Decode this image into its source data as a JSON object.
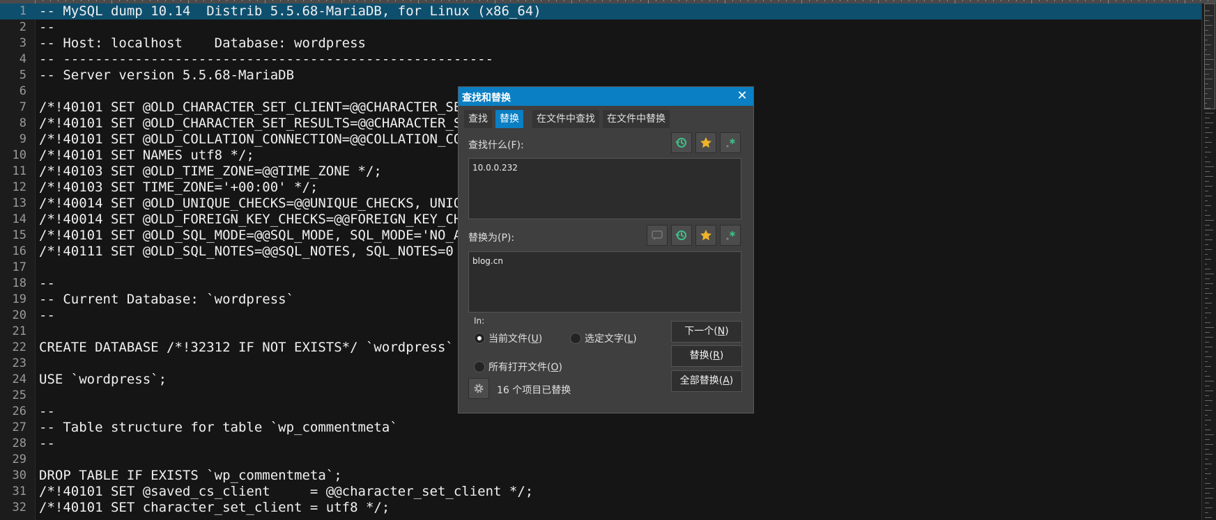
{
  "editor": {
    "current_line": 1,
    "lines": [
      {
        "n": "1",
        "t": "-- MySQL dump 10.14  Distrib 5.5.68-MariaDB, for Linux (x86_64)"
      },
      {
        "n": "2",
        "t": "--"
      },
      {
        "n": "3",
        "t": "-- Host: localhost    Database: wordpress"
      },
      {
        "n": "4",
        "t": "-- ------------------------------------------------------"
      },
      {
        "n": "5",
        "t": "-- Server version 5.5.68-MariaDB"
      },
      {
        "n": "6",
        "t": ""
      },
      {
        "n": "7",
        "t": "/*!40101 SET @OLD_CHARACTER_SET_CLIENT=@@CHARACTER_SET_"
      },
      {
        "n": "8",
        "t": "/*!40101 SET @OLD_CHARACTER_SET_RESULTS=@@CHARACTER_SET"
      },
      {
        "n": "9",
        "t": "/*!40101 SET @OLD_COLLATION_CONNECTION=@@COLLATION_CONN"
      },
      {
        "n": "10",
        "t": "/*!40101 SET NAMES utf8 */;"
      },
      {
        "n": "11",
        "t": "/*!40103 SET @OLD_TIME_ZONE=@@TIME_ZONE */;"
      },
      {
        "n": "12",
        "t": "/*!40103 SET TIME_ZONE='+00:00' */;"
      },
      {
        "n": "13",
        "t": "/*!40014 SET @OLD_UNIQUE_CHECKS=@@UNIQUE_CHECKS, UNIQUE"
      },
      {
        "n": "14",
        "t": "/*!40014 SET @OLD_FOREIGN_KEY_CHECKS=@@FOREIGN_KEY_CHEC"
      },
      {
        "n": "15",
        "t": "/*!40101 SET @OLD_SQL_MODE=@@SQL_MODE, SQL_MODE='NO_AUT"
      },
      {
        "n": "16",
        "t": "/*!40111 SET @OLD_SQL_NOTES=@@SQL_NOTES, SQL_NOTES=0 */"
      },
      {
        "n": "17",
        "t": ""
      },
      {
        "n": "18",
        "t": "--"
      },
      {
        "n": "19",
        "t": "-- Current Database: `wordpress`"
      },
      {
        "n": "20",
        "t": "--"
      },
      {
        "n": "21",
        "t": ""
      },
      {
        "n": "22",
        "t": "CREATE DATABASE /*!32312 IF NOT EXISTS*/ `wordpress` /*                                 ;"
      },
      {
        "n": "23",
        "t": ""
      },
      {
        "n": "24",
        "t": "USE `wordpress`;"
      },
      {
        "n": "25",
        "t": ""
      },
      {
        "n": "26",
        "t": "--"
      },
      {
        "n": "27",
        "t": "-- Table structure for table `wp_commentmeta`"
      },
      {
        "n": "28",
        "t": "--"
      },
      {
        "n": "29",
        "t": ""
      },
      {
        "n": "30",
        "t": "DROP TABLE IF EXISTS `wp_commentmeta`;"
      },
      {
        "n": "31",
        "t": "/*!40101 SET @saved_cs_client     = @@character_set_client */;"
      },
      {
        "n": "32",
        "t": "/*!40101 SET character_set_client = utf8 */;"
      }
    ]
  },
  "dialog": {
    "title": "查找和替换",
    "close_glyph": "✕",
    "tabs": [
      "查找",
      "替换",
      "在文件中查找",
      "在文件中替换"
    ],
    "active_tab": 1,
    "find_label": "查找什么(",
    "find_key": "F",
    "find_label_end": "):",
    "find_value": "10.0.0.232",
    "replace_label": "替换为(",
    "replace_key": "P",
    "replace_label_end": "):",
    "replace_value": "blog.cn",
    "in_label": "In:",
    "scope": {
      "current_file": {
        "text": "当前文件(",
        "key": "U",
        "end": ")",
        "checked": true
      },
      "selection": {
        "text": "选定文字(",
        "key": "L",
        "end": ")",
        "checked": false
      },
      "all_open": {
        "text": "所有打开文件(",
        "key": "O",
        "end": ")",
        "checked": false
      }
    },
    "buttons": {
      "next": {
        "text": "下一个(",
        "key": "N",
        "end": ")"
      },
      "replace": {
        "text": "替换(",
        "key": "R",
        "end": ")"
      },
      "replace_all": {
        "text": "全部替换(",
        "key": "A",
        "end": ")"
      }
    },
    "status": "16 个项目已替换",
    "colors": {
      "accent": "#0a7fc4",
      "history": "#3fbf8a",
      "star": "#f0b429"
    },
    "icons": [
      "history-icon",
      "star-icon",
      "regex-icon",
      "message-icon",
      "gear-icon",
      "close-icon"
    ]
  }
}
